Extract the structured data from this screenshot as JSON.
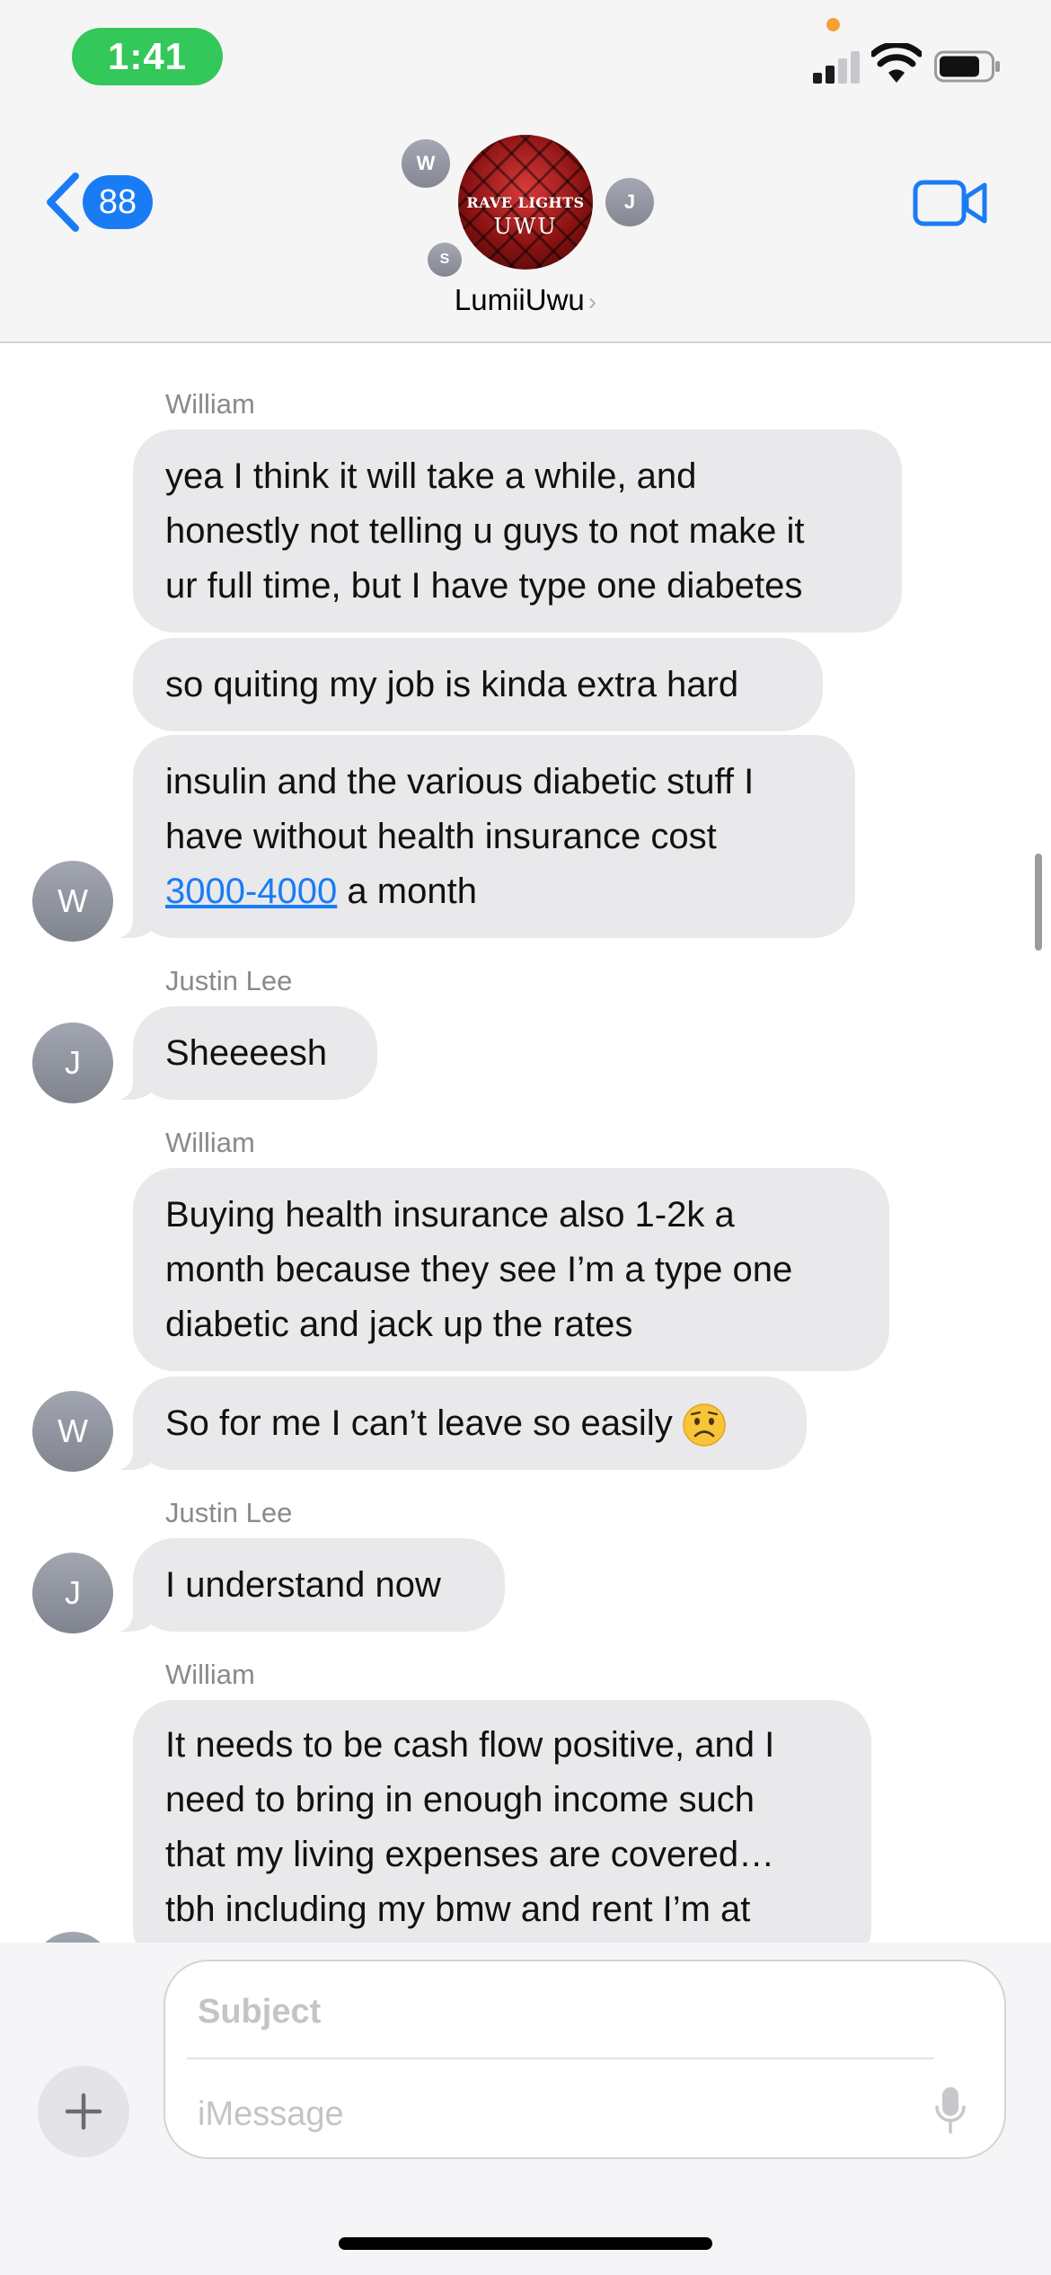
{
  "status_bar": {
    "time": "1:41",
    "icons": [
      "signal-icon",
      "wifi-icon",
      "battery-icon"
    ],
    "privacy_indicator_color": "#f7a034",
    "time_pill_color": "#34c759"
  },
  "header": {
    "back_count": "88",
    "group_name": "LumiiUwu",
    "name_chevron": "›",
    "group_avatar_text_top": "RAVE LIGHTS",
    "group_avatar_text_bottom": "UWU",
    "member_initials": [
      "W",
      "J",
      "S"
    ],
    "video_icon": "video-camera-icon",
    "accent_color": "#1a7cf5"
  },
  "messages": [
    {
      "sender": "William",
      "avatar": "W",
      "bubbles": [
        "yea I think it will take a while, and\nhonestly not telling u guys to not make it\nur full time, but I have type one diabetes",
        "so quiting my job is kinda extra hard",
        {
          "text_before": "insulin and the various diabetic stuff I\nhave without health insurance cost\n",
          "link": "3000-4000",
          "text_after": " a month"
        }
      ]
    },
    {
      "sender": "Justin Lee",
      "avatar": "J",
      "bubbles": [
        "Sheeeesh"
      ]
    },
    {
      "sender": "William",
      "avatar": "W",
      "bubbles": [
        "Buying health insurance also 1-2k a\nmonth because they see I’m a type one\ndiabetic and jack up the rates",
        "So for me I can’t leave so easily"
      ],
      "emoji": "worried-face-emoji"
    },
    {
      "sender": "Justin Lee",
      "avatar": "J",
      "bubbles": [
        "I understand now"
      ]
    },
    {
      "sender": "William",
      "avatar": "W",
      "bubbles": [
        "It needs to be cash flow positive, and I\nneed to bring in enough income such\nthat my living expenses are covered…\ntbh including my bmw and rent I’m at"
      ]
    }
  ],
  "compose": {
    "subject_placeholder": "Subject",
    "message_placeholder": "iMessage",
    "plus_label": "+",
    "mic_icon": "microphone-icon"
  }
}
